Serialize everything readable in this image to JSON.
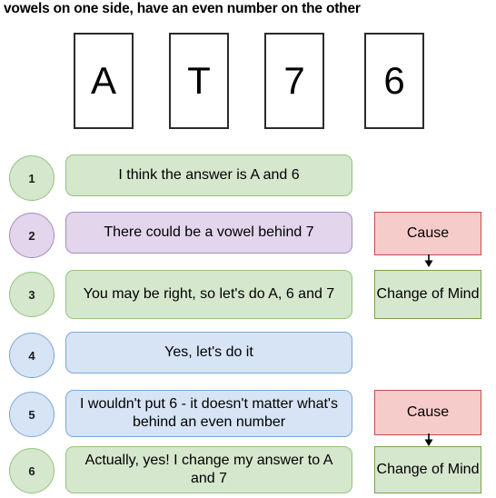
{
  "title": "vowels on one side, have an even number on the other",
  "cards": [
    {
      "label": "A"
    },
    {
      "label": "T"
    },
    {
      "label": "7"
    },
    {
      "label": "6"
    }
  ],
  "conversation": [
    {
      "number": "1",
      "theme": "green",
      "message": "I think the answer is A and 6",
      "tag": null
    },
    {
      "number": "2",
      "theme": "purple",
      "message": "There could be a vowel behind 7",
      "tag": "Cause"
    },
    {
      "number": "3",
      "theme": "green",
      "message": "You may be right, so let's do A, 6 and 7",
      "tag": "Change of Mind"
    },
    {
      "number": "4",
      "theme": "blue",
      "message": "Yes, let's do it",
      "tag": null
    },
    {
      "number": "5",
      "theme": "blue",
      "message": "I wouldn't put 6 - it doesn't matter what's behind an even number",
      "tag": "Cause"
    },
    {
      "number": "6",
      "theme": "green",
      "message": "Actually, yes! I change my answer to A and 7",
      "tag": "Change of Mind"
    }
  ],
  "arrows": [
    {
      "name": "cause-to-change-of-mind-arrow-1",
      "direction": "down"
    },
    {
      "name": "cause-to-change-of-mind-arrow-2",
      "direction": "down"
    }
  ],
  "colors": {
    "green_fill": "#d5e7cd",
    "green_border": "#93c47d",
    "purple_fill": "#e2d5ec",
    "purple_border": "#a68bc1",
    "blue_fill": "#d6e4f5",
    "blue_border": "#7ba7d7",
    "cause_fill": "#f5ccc9",
    "cause_border": "#c0504d",
    "mind_fill": "#d5e7cd",
    "mind_border": "#7aa24f",
    "card_fill": "#ffffff",
    "card_border": "#2b2b2b"
  }
}
